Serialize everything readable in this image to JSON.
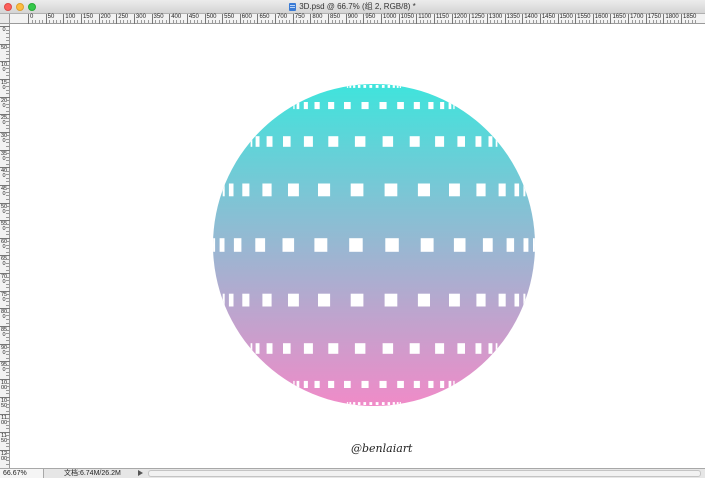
{
  "window": {
    "title": "3D.psd @ 66.7% (组 2, RGB/8) *",
    "file_icon": "psd-file-icon"
  },
  "rulers": {
    "horizontal_labels": [
      "0",
      "50",
      "100",
      "150",
      "200",
      "250",
      "300",
      "350",
      "400",
      "450",
      "500",
      "550",
      "600",
      "650",
      "700",
      "750",
      "800",
      "850",
      "900",
      "950",
      "1000",
      "1050",
      "1100",
      "1150",
      "1200",
      "1250",
      "1300",
      "1350",
      "1400",
      "1450",
      "1500",
      "1550",
      "1600",
      "1650",
      "1700",
      "1750",
      "1800",
      "1850"
    ],
    "vertical_labels": [
      "0",
      "50",
      "100",
      "150",
      "200",
      "250",
      "300",
      "350",
      "400",
      "450",
      "500",
      "550",
      "600",
      "650",
      "700",
      "750",
      "800",
      "850",
      "900",
      "950",
      "1000",
      "1050",
      "1100",
      "1150",
      "1200"
    ]
  },
  "canvas": {
    "signature": "@benlaiart",
    "sphere_gradient_top": "#3fe4dc",
    "sphere_gradient_bottom": "#f08bc8",
    "tile_color": "#ffffff"
  },
  "status": {
    "zoom": "66.67%",
    "doc_info": "文档:6.74M/26.2M"
  },
  "colors": {
    "close": "#fc605c",
    "minimize": "#fdbc40",
    "maximize": "#34c84a"
  }
}
